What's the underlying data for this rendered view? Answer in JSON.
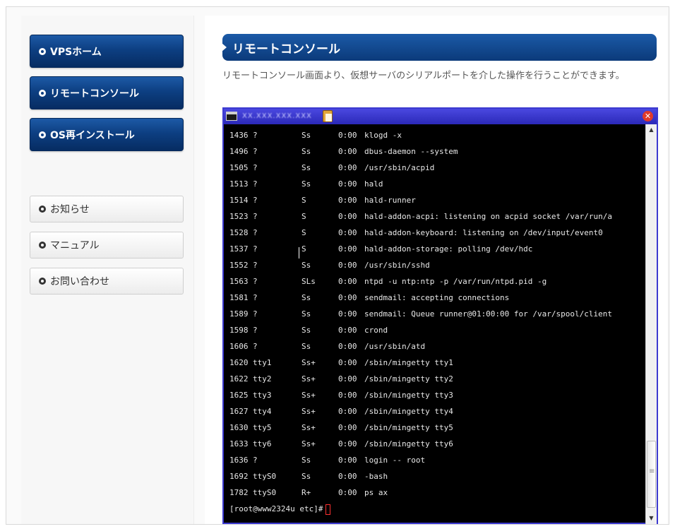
{
  "sidebar": {
    "nav": [
      {
        "label": "VPSホーム"
      },
      {
        "label": "リモートコンソール"
      },
      {
        "label": "OS再インストール"
      }
    ],
    "links": [
      {
        "label": "お知らせ"
      },
      {
        "label": "マニュアル"
      },
      {
        "label": "お問い合わせ"
      }
    ]
  },
  "main": {
    "title": "リモートコンソール",
    "description": "リモートコンソール画面より、仮想サーバのシリアルポートを介した操作を行うことができます。"
  },
  "console": {
    "window_title": "XX.XXX.XXX.XXX",
    "close_glyph": "✕",
    "scroll_up_glyph": "▲",
    "scroll_down_glyph": "▼",
    "processes": [
      {
        "pid": "1436",
        "tty": "?",
        "stat": "Ss",
        "time": "0:00",
        "cmd": "klogd -x"
      },
      {
        "pid": "1496",
        "tty": "?",
        "stat": "Ss",
        "time": "0:00",
        "cmd": "dbus-daemon --system"
      },
      {
        "pid": "1505",
        "tty": "?",
        "stat": "Ss",
        "time": "0:00",
        "cmd": "/usr/sbin/acpid"
      },
      {
        "pid": "1513",
        "tty": "?",
        "stat": "Ss",
        "time": "0:00",
        "cmd": "hald"
      },
      {
        "pid": "1514",
        "tty": "?",
        "stat": "S",
        "time": "0:00",
        "cmd": "hald-runner"
      },
      {
        "pid": "1523",
        "tty": "?",
        "stat": "S",
        "time": "0:00",
        "cmd": "hald-addon-acpi: listening on acpid socket /var/run/a"
      },
      {
        "pid": "1528",
        "tty": "?",
        "stat": "S",
        "time": "0:00",
        "cmd": "hald-addon-keyboard: listening on /dev/input/event0"
      },
      {
        "pid": "1537",
        "tty": "?",
        "stat": "S",
        "time": "0:00",
        "cmd": "hald-addon-storage: polling /dev/hdc"
      },
      {
        "pid": "1552",
        "tty": "?",
        "stat": "Ss",
        "time": "0:00",
        "cmd": "/usr/sbin/sshd"
      },
      {
        "pid": "1563",
        "tty": "?",
        "stat": "SLs",
        "time": "0:00",
        "cmd": "ntpd -u ntp:ntp -p /var/run/ntpd.pid -g"
      },
      {
        "pid": "1581",
        "tty": "?",
        "stat": "Ss",
        "time": "0:00",
        "cmd": "sendmail: accepting connections"
      },
      {
        "pid": "1589",
        "tty": "?",
        "stat": "Ss",
        "time": "0:00",
        "cmd": "sendmail: Queue runner@01:00:00 for /var/spool/client"
      },
      {
        "pid": "1598",
        "tty": "?",
        "stat": "Ss",
        "time": "0:00",
        "cmd": "crond"
      },
      {
        "pid": "1606",
        "tty": "?",
        "stat": "Ss",
        "time": "0:00",
        "cmd": "/usr/sbin/atd"
      },
      {
        "pid": "1620",
        "tty": "tty1",
        "stat": "Ss+",
        "time": "0:00",
        "cmd": "/sbin/mingetty tty1"
      },
      {
        "pid": "1622",
        "tty": "tty2",
        "stat": "Ss+",
        "time": "0:00",
        "cmd": "/sbin/mingetty tty2"
      },
      {
        "pid": "1625",
        "tty": "tty3",
        "stat": "Ss+",
        "time": "0:00",
        "cmd": "/sbin/mingetty tty3"
      },
      {
        "pid": "1627",
        "tty": "tty4",
        "stat": "Ss+",
        "time": "0:00",
        "cmd": "/sbin/mingetty tty4"
      },
      {
        "pid": "1630",
        "tty": "tty5",
        "stat": "Ss+",
        "time": "0:00",
        "cmd": "/sbin/mingetty tty5"
      },
      {
        "pid": "1633",
        "tty": "tty6",
        "stat": "Ss+",
        "time": "0:00",
        "cmd": "/sbin/mingetty tty6"
      },
      {
        "pid": "1636",
        "tty": "?",
        "stat": "Ss",
        "time": "0:00",
        "cmd": "login -- root"
      },
      {
        "pid": "1692",
        "tty": "ttyS0",
        "stat": "Ss",
        "time": "0:00",
        "cmd": "-bash"
      },
      {
        "pid": "1782",
        "tty": "ttyS0",
        "stat": "R+",
        "time": "0:00",
        "cmd": "ps ax"
      }
    ],
    "prompt": "[root@www2324u etc]#"
  },
  "colors": {
    "nav_blue": "#0d3f82",
    "header_blue": "#1b5aa7",
    "console_border": "#3c3ad0",
    "close_red": "#e03a2a"
  }
}
